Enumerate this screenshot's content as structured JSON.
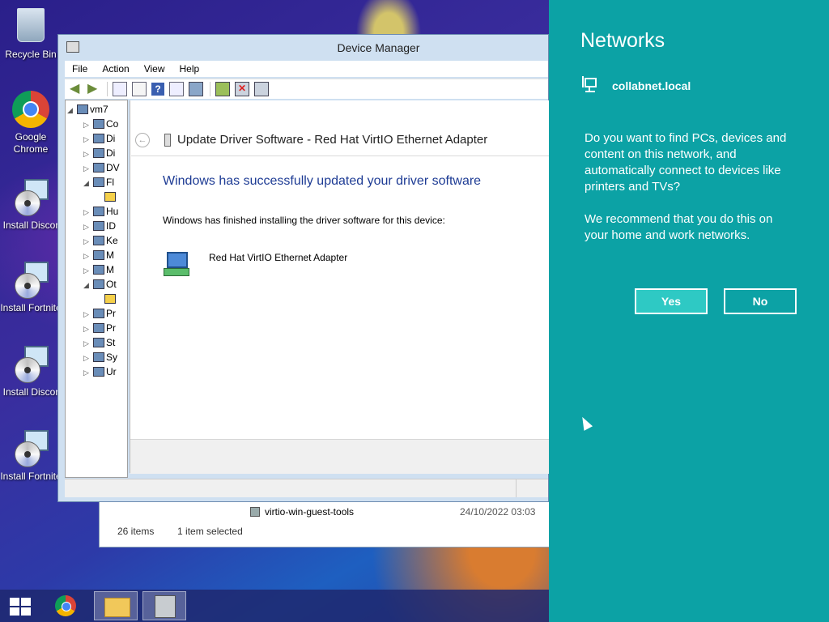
{
  "desktop": {
    "icons": [
      {
        "label": "Recycle Bin",
        "icon": "recycle-bin-icon"
      },
      {
        "label": "Google Chrome",
        "icon": "chrome-icon"
      },
      {
        "label": "Install Discor",
        "icon": "installer-icon"
      },
      {
        "label": "Install Fortnite",
        "icon": "installer-icon"
      },
      {
        "label": "Install Discor",
        "icon": "installer-icon"
      },
      {
        "label": "Install Fortnite",
        "icon": "installer-icon"
      }
    ]
  },
  "explorer": {
    "file_name": "virtio-win-guest-tools",
    "file_date": "24/10/2022 03:03",
    "item_count": "26 items",
    "selection": "1 item selected"
  },
  "device_manager": {
    "title": "Device Manager",
    "menu": [
      "File",
      "Action",
      "View",
      "Help"
    ],
    "tree": {
      "root": "vm7",
      "items": [
        "Co",
        "Di",
        "Di",
        "DV",
        "Fl",
        "",
        "Hu",
        "ID",
        "Ke",
        "M",
        "M",
        "Ot",
        "",
        "Pr",
        "Pr",
        "St",
        "Sy",
        "Ur"
      ]
    }
  },
  "update_driver": {
    "title": "Update Driver Software - Red Hat VirtIO Ethernet Adapter",
    "success_heading": "Windows has successfully updated your driver software",
    "finished_text": "Windows has finished installing the driver software for this device:",
    "device_name": "Red Hat VirtIO Ethernet Adapter"
  },
  "networks_charm": {
    "title": "Networks",
    "network_name": "collabnet.local",
    "prompt": "Do you want to find PCs, devices and content on this network, and automatically connect to devices like printers and TVs?",
    "recommendation": "We recommend that you do this on your home and work networks.",
    "yes_label": "Yes",
    "no_label": "No",
    "accent_color": "#0ca2a5"
  },
  "taskbar": {
    "items": [
      "start-icon",
      "chrome-icon",
      "file-explorer-icon",
      "device-manager-icon"
    ]
  }
}
